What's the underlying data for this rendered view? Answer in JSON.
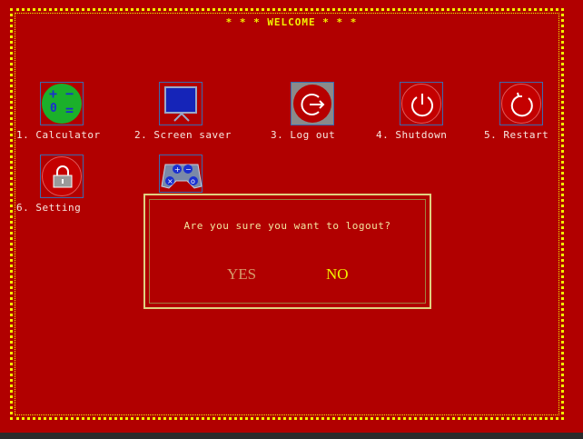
{
  "title": "* * * WELCOME * * *",
  "icons": [
    {
      "label": "1. Calculator",
      "name": "calculator"
    },
    {
      "label": "2. Screen saver",
      "name": "screen-saver"
    },
    {
      "label": "3. Log out",
      "name": "log-out"
    },
    {
      "label": "4. Shutdown",
      "name": "shutdown"
    },
    {
      "label": "5. Restart",
      "name": "restart"
    },
    {
      "label": "6. Setting",
      "name": "setting"
    },
    {
      "label": "",
      "name": "game"
    }
  ],
  "calculator_glyphs": {
    "plus": "+",
    "minus": "−",
    "divide": "0",
    "equals": "="
  },
  "dialog": {
    "message": "Are you sure you want to logout?",
    "yes_label": "YES",
    "no_label": "NO",
    "selected": "NO"
  },
  "colors": {
    "background": "#b10000",
    "border": "#f2f200",
    "label_text": "#f7e8e0",
    "selected_option": "#f2f200",
    "unselected_option": "#d69a6a"
  }
}
